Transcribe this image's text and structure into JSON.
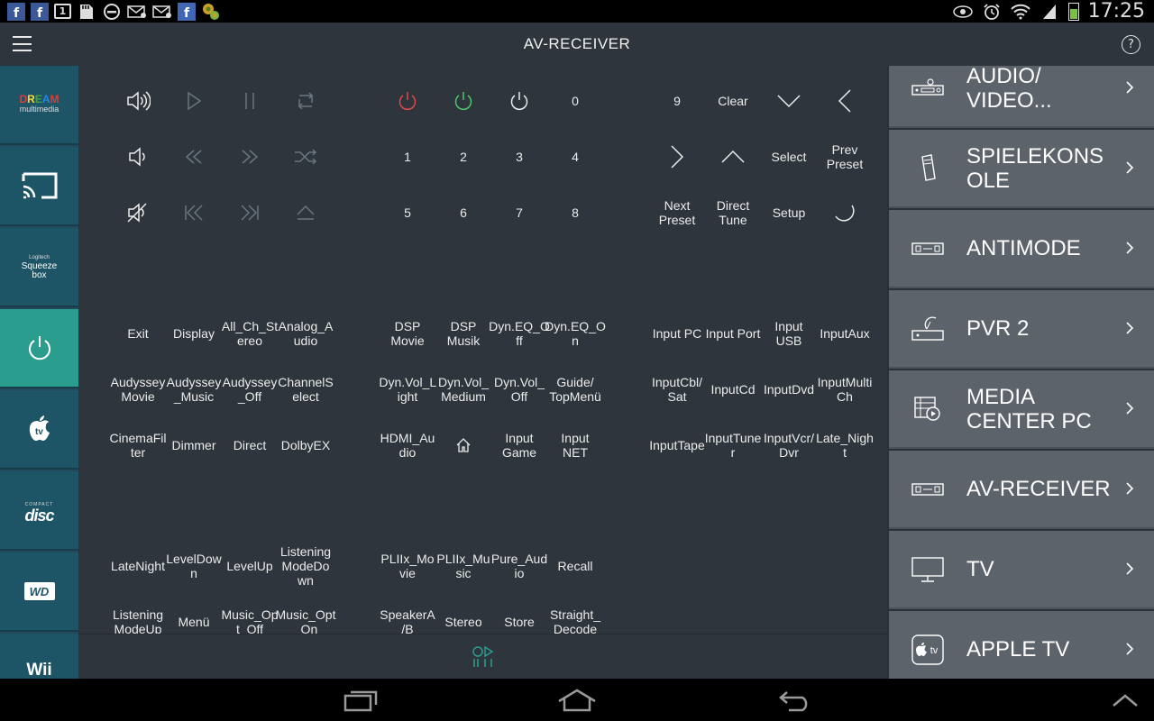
{
  "status_bar": {
    "time": "17:25",
    "left_icons": [
      "facebook-icon",
      "facebook-icon",
      "calendar-icon",
      "sd-card-icon",
      "blocked-icon",
      "email-icon",
      "email-icon",
      "facebook-icon",
      "gear-notification-icon"
    ],
    "calendar_day": "1",
    "right_icons": [
      "eye-icon",
      "alarm-icon",
      "wifi-icon",
      "signal-icon",
      "battery-icon"
    ]
  },
  "app_bar": {
    "title": "AV-RECEIVER",
    "help": "?"
  },
  "sidebar": {
    "items": [
      {
        "name": "dream-multimedia",
        "label_top": "DREAM",
        "label_bottom": "multimedia"
      },
      {
        "name": "cast",
        "label": ""
      },
      {
        "name": "squeezebox",
        "label_top": "Logitech",
        "label_mid": "Squeeze",
        "label_bottom": "box"
      },
      {
        "name": "power",
        "label": "",
        "active": true
      },
      {
        "name": "apple-tv",
        "label": "tv"
      },
      {
        "name": "compact-disc",
        "label_top": "COMPACT",
        "label_bottom": "disc"
      },
      {
        "name": "wd",
        "label": "WD"
      },
      {
        "name": "wii",
        "label": "Wii"
      }
    ]
  },
  "remote": {
    "rows": [
      [
        "",
        "",
        "",
        "",
        "",
        "",
        "",
        "0",
        "",
        "9",
        "Clear",
        "",
        ""
      ],
      [
        "",
        "",
        "",
        "",
        "1",
        "2",
        "3",
        "4",
        "",
        "",
        "",
        "Select",
        "Prev Preset"
      ],
      [
        "",
        "",
        "",
        "",
        "5",
        "6",
        "7",
        "8",
        "",
        "Next Preset",
        "Direct Tune",
        "Setup",
        ""
      ],
      [
        "Exit",
        "Display",
        "All_Ch_St ereo",
        "Analog_A udio",
        "DSP Movie",
        "DSP Musik",
        "Dyn.EQ_O ff",
        "Dyn.EQ_O n",
        "",
        "Input PC",
        "Input Port",
        "Input USB",
        "InputAux"
      ],
      [
        "Audyssey Movie",
        "Audyssey _Music",
        "Audyssey _Off",
        "ChannelS elect",
        "Dyn.Vol_L ight",
        "Dyn.Vol_ Medium",
        "Dyn.Vol_ Off",
        "Guide/ TopMenü",
        "",
        "InputCbl/ Sat",
        "InputCd",
        "InputDvd",
        "InputMulti Ch"
      ],
      [
        "CinemaFil ter",
        "Dimmer",
        "Direct",
        "DolbyEX",
        "HDMI_Au dio",
        "",
        "Input Game",
        "Input NET",
        "",
        "InputTape",
        "InputTune r",
        "InputVcr/ Dvr",
        "Late_Nigh t"
      ],
      [
        "LateNight",
        "LevelDow n",
        "LevelUp",
        "Listening ModeDo wn",
        "PLIIx_Mo vie",
        "PLIIx_Mu sic",
        "Pure_Aud io",
        "Recall",
        "",
        "",
        "",
        "",
        ""
      ],
      [
        "Listening ModeUp",
        "Menü",
        "Music_Op t_Off",
        "Music_Opt _On",
        "SpeakerA /B",
        "Stereo",
        "Store",
        "Straight_ Decode",
        "",
        "",
        "",
        "",
        ""
      ]
    ]
  },
  "devices": [
    {
      "label": "AUDIO/ VIDEO...",
      "icon": "receiver-icon"
    },
    {
      "label": "SPIELEKONS OLE",
      "icon": "game-console-icon"
    },
    {
      "label": "ANTIMODE",
      "icon": "amplifier-icon"
    },
    {
      "label": "PVR 2",
      "icon": "satellite-receiver-icon"
    },
    {
      "label": "MEDIA CENTER PC",
      "icon": "media-center-icon"
    },
    {
      "label": "AV-RECEIVER",
      "icon": "av-receiver-icon"
    },
    {
      "label": "TV",
      "icon": "tv-monitor-icon"
    },
    {
      "label": "APPLE TV",
      "icon": "apple-tv-icon"
    }
  ],
  "colors": {
    "accent": "#2a9d8f",
    "power_red": "#e0484a",
    "power_green": "#4cc76a",
    "panel": "#2e353c",
    "device_tile": "#5c636a"
  }
}
